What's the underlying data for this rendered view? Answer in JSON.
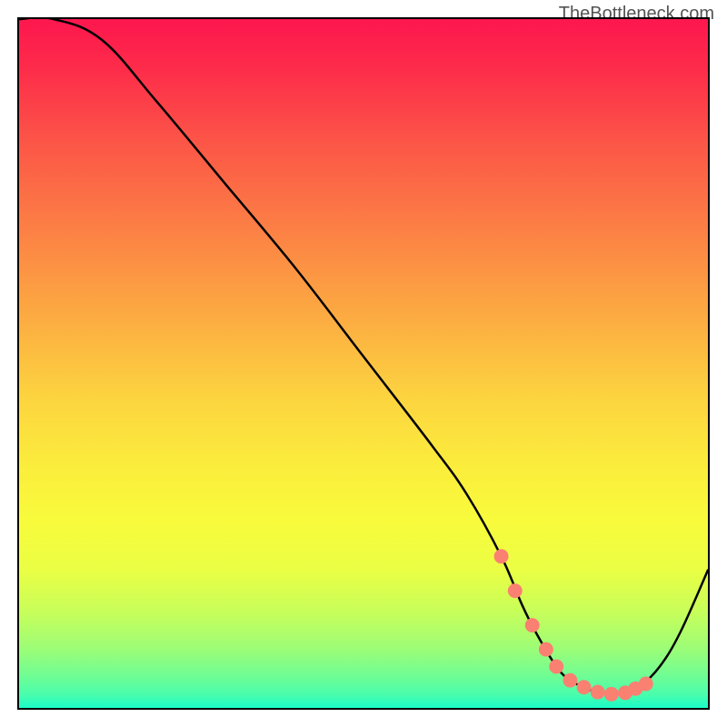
{
  "attribution": "TheBottleneck.com",
  "chart_data": {
    "type": "line",
    "title": "",
    "xlabel": "",
    "ylabel": "",
    "xlim": [
      0,
      100
    ],
    "ylim": [
      0,
      100
    ],
    "grid": false,
    "series": [
      {
        "name": "curve",
        "x": [
          0,
          5,
          12,
          20,
          30,
          40,
          50,
          60,
          65,
          70,
          73,
          75,
          78,
          80,
          82,
          84,
          86,
          88,
          90,
          93,
          96,
          100
        ],
        "values": [
          100,
          100,
          97,
          88,
          76,
          64,
          51,
          38,
          31,
          22,
          15,
          11,
          6,
          4,
          3,
          2.2,
          2,
          2.2,
          3,
          6,
          11,
          20
        ]
      }
    ],
    "markers": {
      "name": "dots",
      "color": "#fa8072",
      "x": [
        70,
        72,
        74.5,
        76.5,
        78,
        80,
        82,
        84,
        86,
        88,
        89.5,
        91
      ],
      "values": [
        22,
        17,
        12,
        8.5,
        6,
        4,
        3,
        2.3,
        2,
        2.2,
        2.8,
        3.5
      ]
    },
    "background_gradient": [
      {
        "stop": 0.0,
        "color": "#fd174e"
      },
      {
        "stop": 0.07,
        "color": "#fd2b4a"
      },
      {
        "stop": 0.18,
        "color": "#fc5647"
      },
      {
        "stop": 0.3,
        "color": "#fc7e45"
      },
      {
        "stop": 0.42,
        "color": "#fca742"
      },
      {
        "stop": 0.55,
        "color": "#fcd43f"
      },
      {
        "stop": 0.65,
        "color": "#fbed3c"
      },
      {
        "stop": 0.73,
        "color": "#f8fb3c"
      },
      {
        "stop": 0.8,
        "color": "#eafe44"
      },
      {
        "stop": 0.86,
        "color": "#c8fe5a"
      },
      {
        "stop": 0.91,
        "color": "#a0fd74"
      },
      {
        "stop": 0.95,
        "color": "#74fd91"
      },
      {
        "stop": 0.98,
        "color": "#4bfdac"
      },
      {
        "stop": 1.0,
        "color": "#1afcc9"
      }
    ]
  }
}
